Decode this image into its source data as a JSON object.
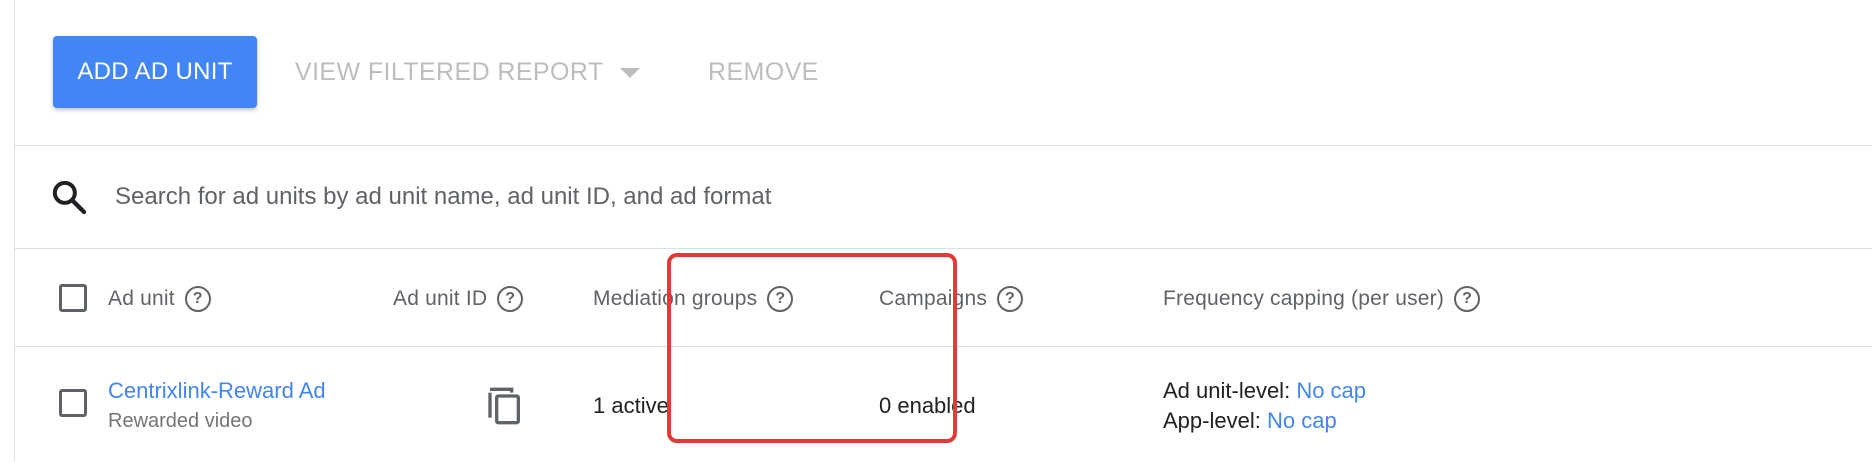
{
  "toolbar": {
    "add_label": "ADD AD UNIT",
    "view_label": "VIEW FILTERED REPORT",
    "remove_label": "REMOVE"
  },
  "search": {
    "placeholder": "Search for ad units by ad unit name, ad unit ID, and ad format"
  },
  "table": {
    "headers": {
      "ad_unit": "Ad unit",
      "ad_unit_id": "Ad unit ID",
      "mediation_groups": "Mediation groups",
      "campaigns": "Campaigns",
      "frequency_capping": "Frequency capping (per user)"
    },
    "rows": [
      {
        "name": "Centrixlink-Reward Ad",
        "format": "Rewarded video",
        "mediation": "1 active",
        "campaigns": "0 enabled",
        "ad_unit_level_label": "Ad unit-level:",
        "ad_unit_level_value": "No cap",
        "app_level_label": "App-level:",
        "app_level_value": "No cap"
      }
    ]
  },
  "colors": {
    "primary": "#4285f4",
    "highlight": "#e53935",
    "disabled_text": "#bdbdbd"
  },
  "icons": {
    "search": "search-icon",
    "help": "help-icon",
    "copy": "copy-icon",
    "dropdown": "caret-down-icon"
  }
}
